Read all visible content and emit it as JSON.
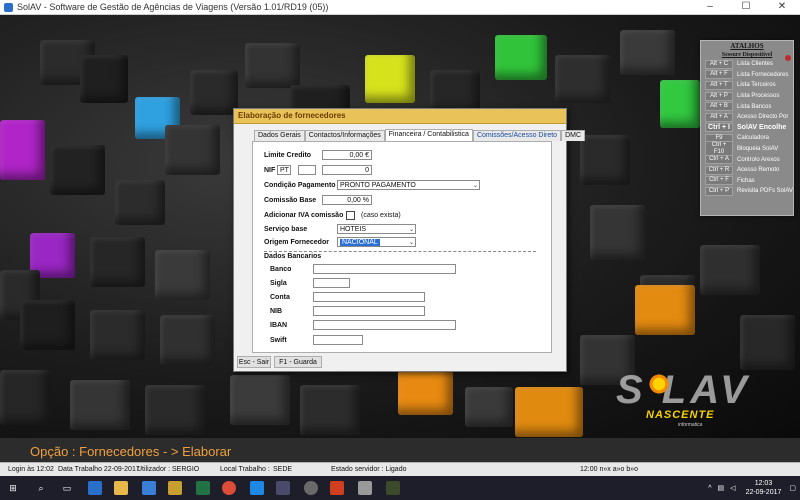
{
  "window": {
    "title": "SolAV - Software de Gestão de Agências de Viagens (Versão 1.01/RD19 (05))",
    "controls": {
      "minimize": "–",
      "maximize": "☐",
      "close": "✕"
    }
  },
  "shortcuts": {
    "header": "ATALHOS",
    "subheader": "Sessure Dispositivel",
    "items": [
      {
        "key": "Alt + C",
        "label": "Lista Clientes"
      },
      {
        "key": "Alt + F",
        "label": "Lista Fornecedores"
      },
      {
        "key": "Alt + T",
        "label": "Lista Terceiros"
      },
      {
        "key": "Alt + P",
        "label": "Lista Processos"
      },
      {
        "key": "Alt + B",
        "label": "Lista Bancos"
      },
      {
        "key": "Alt + A",
        "label": "Acesso Directo Por"
      },
      {
        "key": "Ctrl + I",
        "label": "SolAV Encolhe",
        "bold": true
      },
      {
        "key": "F9",
        "label": "Calculadora"
      },
      {
        "key": "Ctrl + F10",
        "label": "Bloqueia SolAV"
      },
      {
        "key": "Ctrl + A",
        "label": "Controlo Arexos"
      },
      {
        "key": "Ctrl + R",
        "label": "Acesso Remoto"
      },
      {
        "key": "Ctrl + F",
        "label": "Fichas"
      },
      {
        "key": "Ctrl + P",
        "label": "Revisita PDFs SolAV"
      }
    ]
  },
  "logo": {
    "main": "S  LAV",
    "sub": "NASCENTE",
    "small": "informatica"
  },
  "dialog": {
    "title": "Elaboração de fornecedores",
    "tabs": [
      {
        "label": "Dados Gerais",
        "active": false
      },
      {
        "label": "Contactos/Informações",
        "active": false
      },
      {
        "label": "Financeira / Contabilistica",
        "active": true
      },
      {
        "label": "Comissões/Acesso Direto",
        "active": false
      },
      {
        "label": "DMC",
        "active": false
      }
    ],
    "form": {
      "limite_credito_label": "Limite Credito",
      "limite_credito_value": "0,00 €",
      "nif_label": "NIF",
      "nif_country": "PT",
      "nif_prefix": "",
      "nif_value": "0",
      "condicao_label": "Condição Pagamento",
      "condicao_value": "PRONTO PAGAMENTO",
      "comissao_label": "Comissão Base",
      "comissao_value": "0,00 %",
      "iva_label": "Adicionar IVA comissão",
      "iva_hint": "(caso exista)",
      "iva_checked": false,
      "servico_label": "Serviço base",
      "servico_value": "HOTEIS",
      "origem_label": "Origem Fornecedor",
      "origem_value": "NACIONAL",
      "bank_section_label": "Dados Bancarios",
      "banco_label": "Banco",
      "banco_value": "",
      "sigla_label": "Sigla",
      "sigla_value": "",
      "conta_label": "Conta",
      "conta_value": "",
      "nib_label": "NIB",
      "nib_value": "",
      "iban_label": "IBAN",
      "iban_value": "",
      "swift_label": "Swift",
      "swift_value": ""
    },
    "buttons": {
      "exit": "Esc - Sair",
      "save": "F1 - Guarda"
    }
  },
  "opcao": {
    "text": "Opção : Fornecedores - > Elaborar"
  },
  "status": {
    "login": "Login às 12:02",
    "data_trabalho": "Data Trabalho 22-09-2017",
    "utilizador": "Utilizador : SERGIO",
    "local": "Local Trabalho :",
    "local_value": "SEDE",
    "estado": "Estado servidor : Ligado",
    "time_right": "12:00 n»x a»o b»o"
  },
  "taskbar": {
    "time": "12:03",
    "date": "22-09-2017"
  },
  "colors": {
    "dialog_title_bg": "#e9c25a",
    "opcao_text": "#f0a040",
    "selection_blue": "#2a6fd6"
  }
}
